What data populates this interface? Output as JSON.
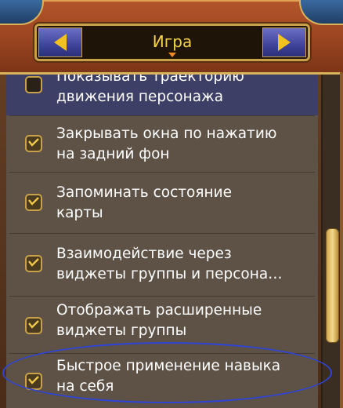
{
  "header": {
    "tab_title": "Игра",
    "prev_icon": "arrow-left-icon",
    "next_icon": "arrow-right-icon"
  },
  "options": [
    {
      "label": "Показывать траекторию\nдвижения персонажа",
      "checked": false
    },
    {
      "label": "Закрывать окна по нажатию\nна задний фон",
      "checked": true
    },
    {
      "label": "Запоминать состояние\nкарты",
      "checked": true
    },
    {
      "label": "Взаимодействие через\nвиджеты группы и персона…",
      "checked": true
    },
    {
      "label": "Отображать расширенные\nвиджеты группы",
      "checked": true
    },
    {
      "label": "Быстрое применение навыка\nна себя",
      "checked": true
    }
  ],
  "colors": {
    "accent_gold": "#c8a04a",
    "tab_text": "#f6d24a",
    "highlight_row": "#3d3f66",
    "annotation": "#2e44d8"
  }
}
